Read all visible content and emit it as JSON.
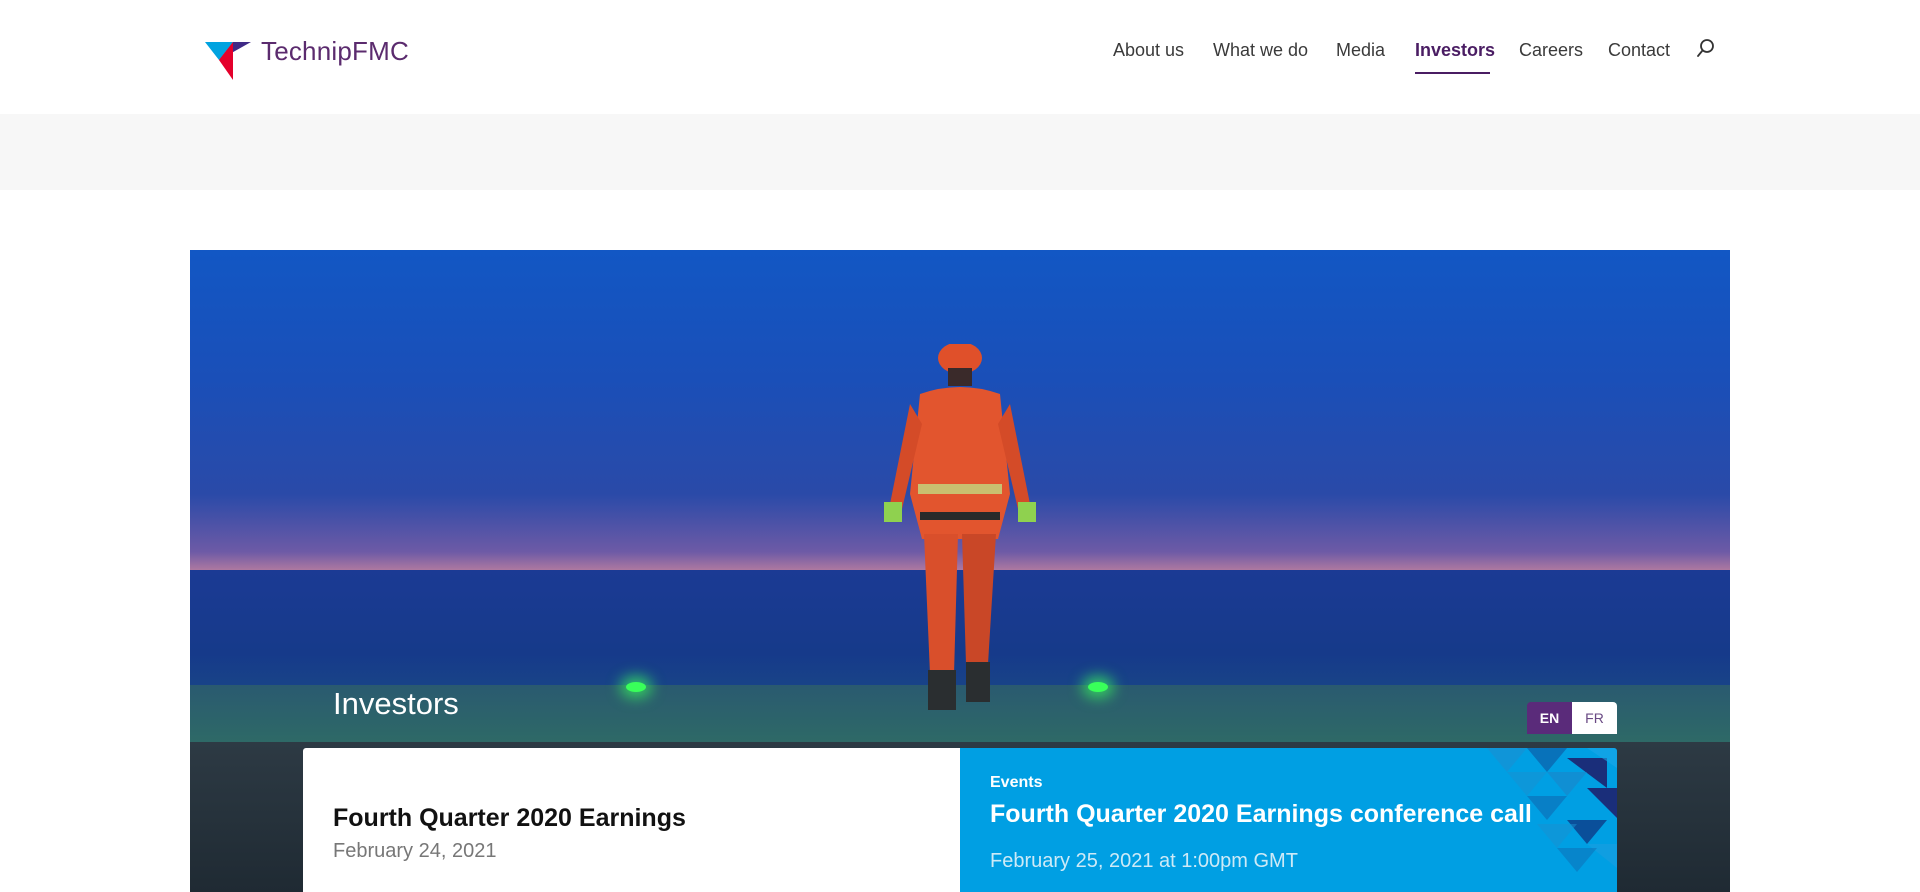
{
  "header": {
    "logo_text": "TechnipFMC",
    "nav": {
      "about": "About us",
      "what": "What we do",
      "media": "Media",
      "investors": "Investors",
      "careers": "Careers",
      "contact": "Contact"
    }
  },
  "hero": {
    "title": "Investors",
    "languages": {
      "en": "EN",
      "fr": "FR"
    }
  },
  "cards": {
    "left": {
      "title": "Fourth Quarter 2020 Earnings",
      "date": "February 24, 2021"
    },
    "right": {
      "kicker": "Events",
      "title": "Fourth Quarter 2020 Earnings conference call",
      "date": "February 25, 2021 at 1:00pm GMT"
    }
  },
  "colors": {
    "brand_purple": "#4a1d63",
    "event_blue": "#009fe3"
  }
}
